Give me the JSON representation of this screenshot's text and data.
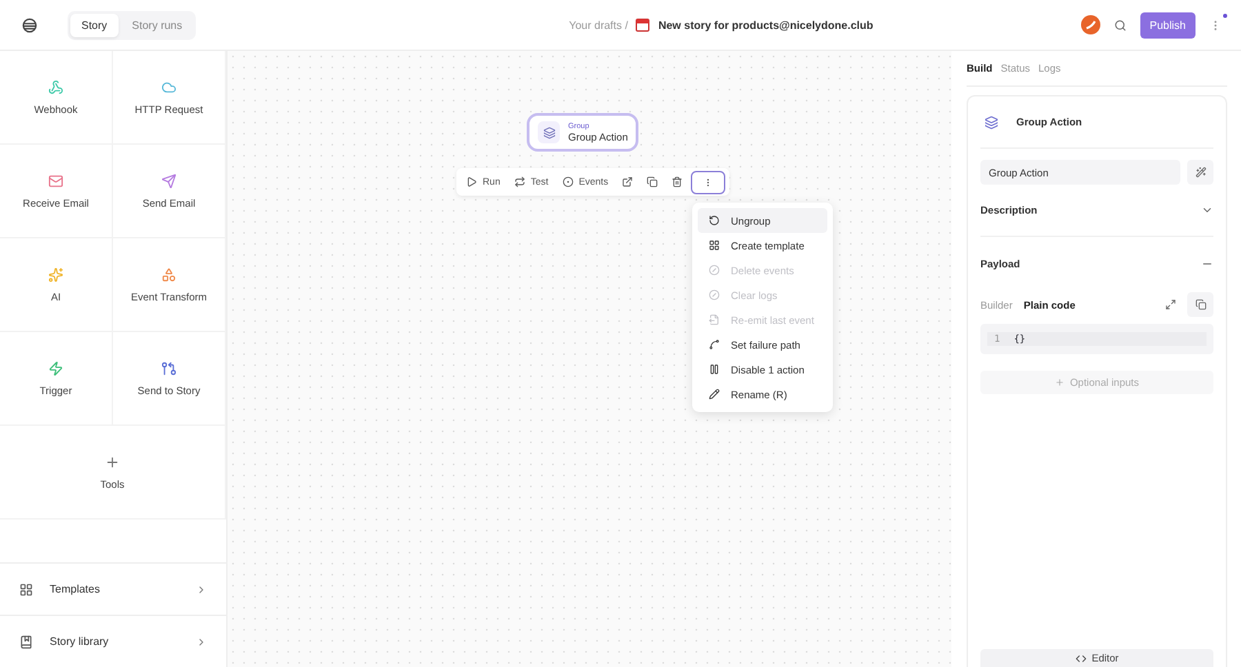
{
  "topbar": {
    "tabs": [
      {
        "label": "Story",
        "selected": true
      },
      {
        "label": "Story runs",
        "selected": false
      }
    ],
    "breadcrumb": "Your drafts /",
    "title": "New story for products@nicelydone.club",
    "publish": "Publish",
    "notification": true
  },
  "sidebar": {
    "tiles": [
      {
        "label": "Webhook",
        "color": "#3cc9a8"
      },
      {
        "label": "HTTP Request",
        "color": "#56b8d8"
      },
      {
        "label": "Receive Email",
        "color": "#e8728a"
      },
      {
        "label": "Send Email",
        "color": "#b57be0"
      },
      {
        "label": "AI",
        "color": "#f0b429"
      },
      {
        "label": "Event Transform",
        "color": "#f08a4b"
      },
      {
        "label": "Trigger",
        "color": "#3dbf7a"
      },
      {
        "label": "Send to Story",
        "color": "#5b6fd6"
      }
    ],
    "tools": {
      "label": "Tools"
    },
    "links": [
      {
        "label": "Templates"
      },
      {
        "label": "Story library"
      }
    ]
  },
  "canvas": {
    "node": {
      "type": "Group",
      "name": "Group Action",
      "selected": true
    },
    "toolbar": [
      {
        "label": "Run"
      },
      {
        "label": "Test"
      },
      {
        "label": "Events"
      }
    ],
    "menu": [
      {
        "label": "Ungroup",
        "disabled": false,
        "highlighted": true
      },
      {
        "label": "Create template",
        "disabled": false,
        "highlighted": false
      },
      {
        "label": "Delete events",
        "disabled": true,
        "highlighted": false
      },
      {
        "label": "Clear logs",
        "disabled": true,
        "highlighted": false
      },
      {
        "label": "Re-emit last event",
        "disabled": true,
        "highlighted": false
      },
      {
        "label": "Set failure path",
        "disabled": false,
        "highlighted": false
      },
      {
        "label": "Disable 1 action",
        "disabled": false,
        "highlighted": false
      },
      {
        "label": "Rename (R)",
        "disabled": false,
        "highlighted": false
      }
    ]
  },
  "panel": {
    "tabs": [
      {
        "label": "Build",
        "selected": true
      },
      {
        "label": "Status",
        "selected": false
      },
      {
        "label": "Logs",
        "selected": false
      }
    ],
    "header": "Group Action",
    "name_value": "Group Action",
    "sections": [
      {
        "title": "Description",
        "expanded": false
      },
      {
        "title": "Payload",
        "expanded": true
      }
    ],
    "payload_tabs": [
      {
        "label": "Builder",
        "selected": false
      },
      {
        "label": "Plain code",
        "selected": true
      }
    ],
    "code": [
      {
        "line": "1",
        "text": "{}"
      }
    ],
    "optional_inputs": "Optional inputs",
    "editor": "Editor"
  }
}
